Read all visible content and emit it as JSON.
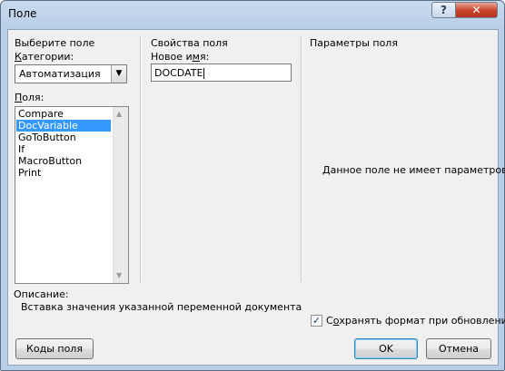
{
  "window": {
    "title": "Поле",
    "help_label": "?",
    "close_label": "✕"
  },
  "left": {
    "section_title": "Выберите поле",
    "categories_label": "Категории:",
    "categories_value": "Автоматизация",
    "fields_label": "Поля:",
    "fields": [
      "Compare",
      "DocVariable",
      "GoToButton",
      "If",
      "MacroButton",
      "Print"
    ],
    "selected_index": 1
  },
  "middle": {
    "section_title": "Свойства поля",
    "new_name_label": "Новое имя:",
    "new_name_value": "DOCDATE"
  },
  "right": {
    "section_title": "Параметры поля",
    "no_params_text": "Данное поле не имеет параметров",
    "preserve_format_label": "Сохранять формат при обновлении",
    "preserve_format_checked": true
  },
  "description": {
    "label": "Описание:",
    "text": "Вставка значения указанной переменной документа"
  },
  "buttons": {
    "field_codes": "Коды поля",
    "ok": "OK",
    "cancel": "Отмена"
  },
  "icons": {
    "dropdown": "chevron-down-icon",
    "check": "checkmark-icon"
  }
}
